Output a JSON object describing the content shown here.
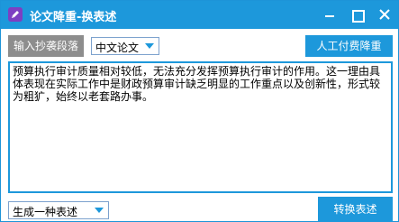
{
  "window": {
    "title": "论文降重-换表述",
    "icon": "pen-app-icon",
    "controls": [
      "minimize-icon",
      "maximize-icon",
      "close-icon"
    ]
  },
  "toolbar": {
    "input_button_label": "输入抄袭段落",
    "language_select_value": "中文论文",
    "manual_button_label": "人工付费降重"
  },
  "editor": {
    "text": "预算执行审计质量相对较低，无法充分发挥预算执行审计的作用。这一理由具体表现在实际工作中是财政预算审计缺乏明显的工作重点以及创新性，形式较为粗犷，始终以老套路办事。"
  },
  "footer": {
    "mode_select_value": "生成一种表述",
    "convert_button_label": "转换表述"
  },
  "colors": {
    "accent": "#1d98db",
    "gray_button": "#8d8d8d",
    "app_icon": "#7d3fc2"
  }
}
